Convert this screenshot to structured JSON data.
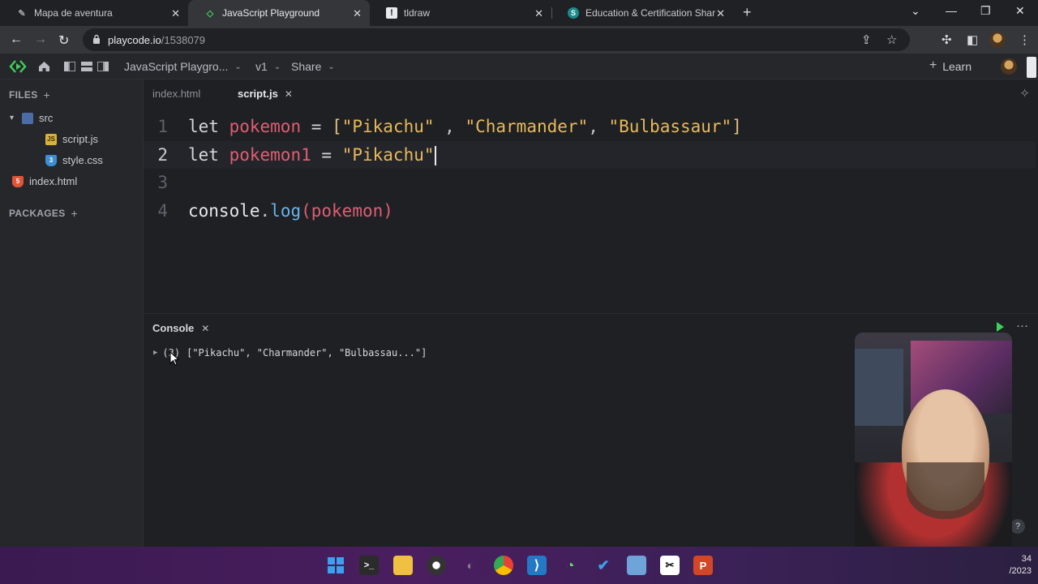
{
  "browser": {
    "tabs": [
      {
        "title": "Mapa de aventura",
        "active": false
      },
      {
        "title": "JavaScript Playground",
        "active": true
      },
      {
        "title": "tldraw",
        "active": false
      },
      {
        "title": "Education & Certification Shared",
        "active": false
      }
    ],
    "url_host": "playcode.io",
    "url_path": "/1538079"
  },
  "app": {
    "project_title": "JavaScript Playgro...",
    "version": "v1",
    "share_label": "Share",
    "learn_label": "Learn"
  },
  "sidebar": {
    "files_header": "FILES",
    "tree": [
      {
        "name": "src",
        "type": "folder"
      },
      {
        "name": "script.js",
        "type": "js"
      },
      {
        "name": "style.css",
        "type": "css"
      },
      {
        "name": "index.html",
        "type": "html"
      }
    ],
    "packages_header": "PACKAGES"
  },
  "editor": {
    "file_tabs": [
      {
        "name": "index.html",
        "active": false
      },
      {
        "name": "script.js",
        "active": true
      }
    ],
    "line_numbers": [
      "1",
      "2",
      "3",
      "4"
    ]
  },
  "console": {
    "title": "Console",
    "output_count": "(3)",
    "output_text": "[\"Pikachu\", \"Charmander\", \"Bulbassau...\"]"
  },
  "taskbar": {
    "clock_line1": "34",
    "clock_line2": "/2023"
  },
  "colors": {
    "accent_green": "#3ecf59",
    "keyword": "#d6d6d6",
    "variable": "#e05d72",
    "string": "#e8b95a",
    "method": "#67b4ec"
  }
}
